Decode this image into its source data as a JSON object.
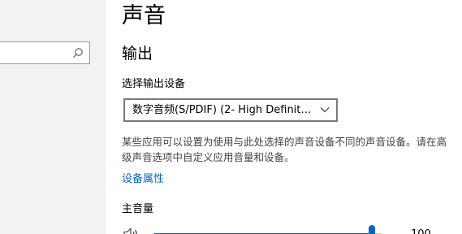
{
  "page": {
    "title": "声音"
  },
  "search": {
    "placeholder": ""
  },
  "output": {
    "section_title": "输出",
    "device_label": "选择输出设备",
    "selected_device": "数字音频(S/PDIF) (2- High Definition...",
    "description": "某些应用可以设置为使用与此处选择的声音设备不同的声音设备。请在高级声音选项中自定义应用音量和设备。",
    "device_properties_link": "设备属性",
    "volume_label": "主音量",
    "volume_value": "100"
  },
  "colors": {
    "accent": "#0067c0",
    "left_pane_bg": "#f2f2f2"
  },
  "icons": {
    "search": "search-icon",
    "dropdown": "chevron-down-icon",
    "speaker": "speaker-icon"
  }
}
